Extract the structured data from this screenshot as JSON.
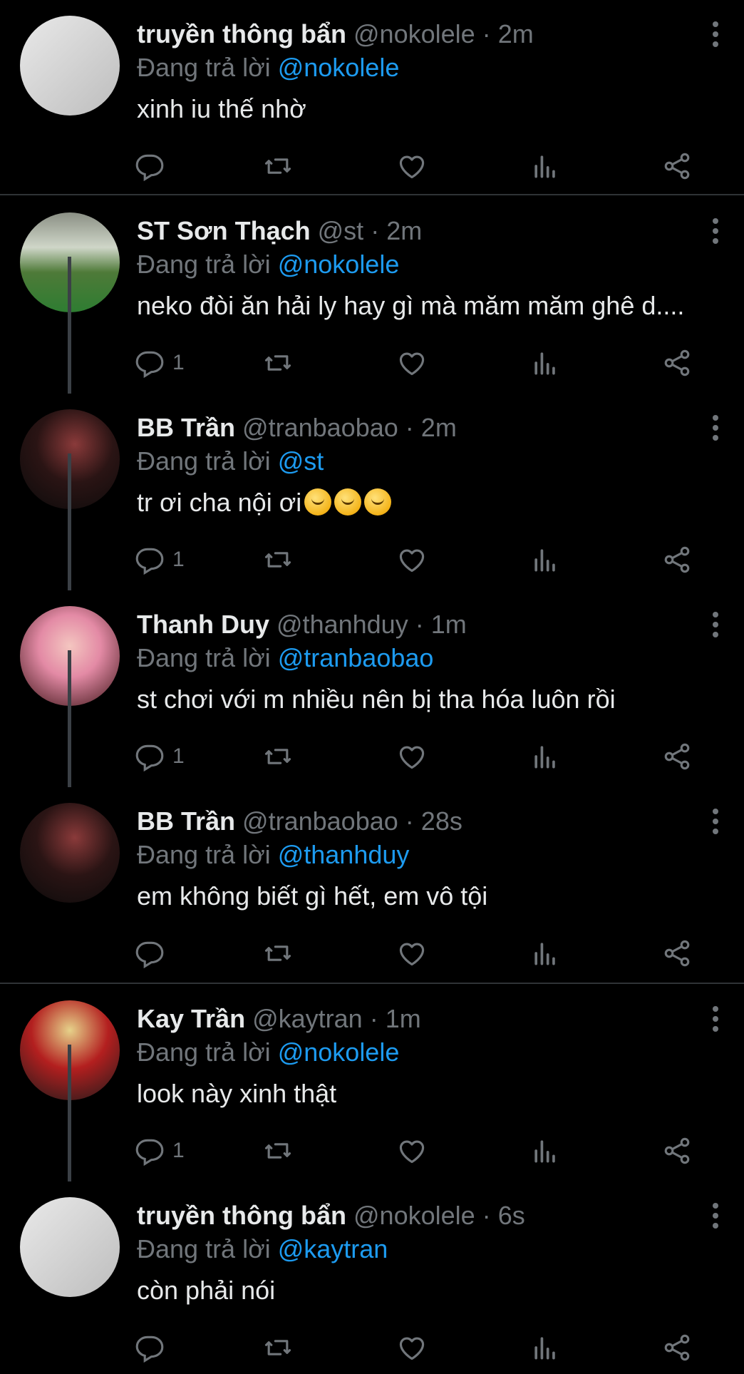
{
  "reply_prefix": "Đang trả lời",
  "tweets": [
    {
      "name": "truyền thông bẩn",
      "handle": "@nokolele",
      "dot": "·",
      "time": "2m",
      "reply_to": "@nokolele",
      "text": "xinh iu thế nhờ",
      "reply_count": ""
    },
    {
      "name": "ST Sơn Thạch",
      "handle": "@st",
      "dot": "·",
      "time": "2m",
      "reply_to": "@nokolele",
      "text": "neko đòi ăn hải ly hay gì mà măm măm ghê d....",
      "reply_count": "1"
    },
    {
      "name": "BB Trần",
      "handle": "@tranbaobao",
      "dot": "·",
      "time": "2m",
      "reply_to": "@st",
      "text": "tr ơi cha nội ơi",
      "emoji_count": 3,
      "reply_count": "1"
    },
    {
      "name": "Thanh Duy",
      "handle": "@thanhduy",
      "dot": "·",
      "time": "1m",
      "reply_to": "@tranbaobao",
      "text": "st chơi với m nhiều nên bị tha hóa luôn rồi",
      "reply_count": "1"
    },
    {
      "name": "BB Trần",
      "handle": "@tranbaobao",
      "dot": "·",
      "time": "28s",
      "reply_to": "@thanhduy",
      "text": "em không biết gì hết, em vô tội",
      "reply_count": ""
    },
    {
      "name": "Kay Trần",
      "handle": "@kaytran",
      "dot": "·",
      "time": "1m",
      "reply_to": "@nokolele",
      "text": "look này xinh thật",
      "reply_count": "1"
    },
    {
      "name": "truyền thông bẩn",
      "handle": "@nokolele",
      "dot": "·",
      "time": "6s",
      "reply_to": "@kaytran",
      "text": "còn phải nói",
      "reply_count": ""
    }
  ],
  "icons": {
    "reply": "reply-icon",
    "retweet": "retweet-icon",
    "like": "like-icon",
    "views": "views-icon",
    "share": "share-icon",
    "more": "more-icon"
  },
  "colors": {
    "background": "#000000",
    "text": "#e7e9ea",
    "secondary": "#71767b",
    "mention": "#1d9bf0",
    "divider": "#2f3336"
  }
}
